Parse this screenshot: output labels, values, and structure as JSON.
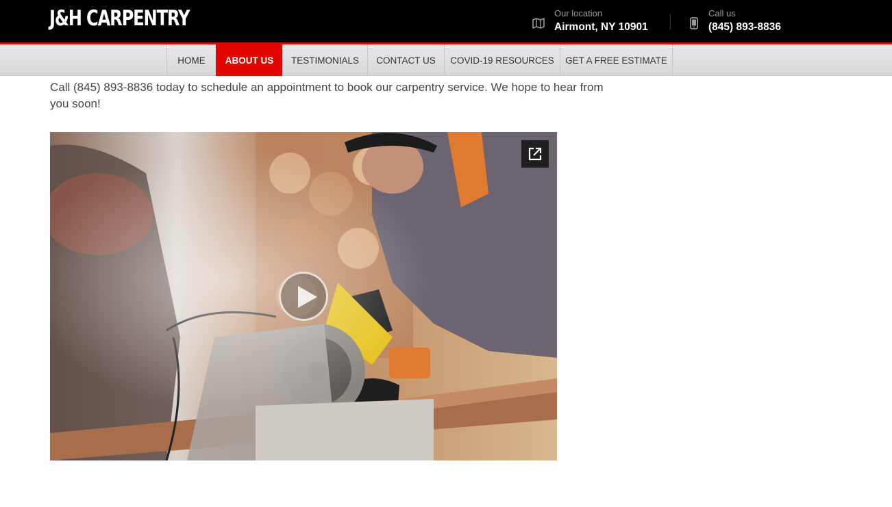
{
  "header": {
    "logo_text": "J&H CARPENTRY",
    "location": {
      "icon": "map-icon",
      "label": "Our location",
      "value": "Airmont, NY 10901"
    },
    "phone": {
      "icon": "phone-icon",
      "label": "Call us",
      "value": "(845) 893-8836"
    }
  },
  "nav": {
    "items": [
      {
        "label": "HOME",
        "active": false
      },
      {
        "label": "ABOUT US",
        "active": true
      },
      {
        "label": "TESTIMONIALS",
        "active": false
      },
      {
        "label": "CONTACT US",
        "active": false
      },
      {
        "label": "COVID-19 RESOURCES",
        "active": false
      },
      {
        "label": "GET A FREE ESTIMATE",
        "active": false
      }
    ]
  },
  "main": {
    "intro_text": "Call (845) 893-8836 today to schedule an appointment to book our carpentry service. We hope to hear from you soon!"
  },
  "video": {
    "play_icon": "play-icon",
    "popout_icon": "external-link-icon"
  },
  "colors": {
    "brand_red": "#e10600",
    "header_bg": "#000000"
  }
}
